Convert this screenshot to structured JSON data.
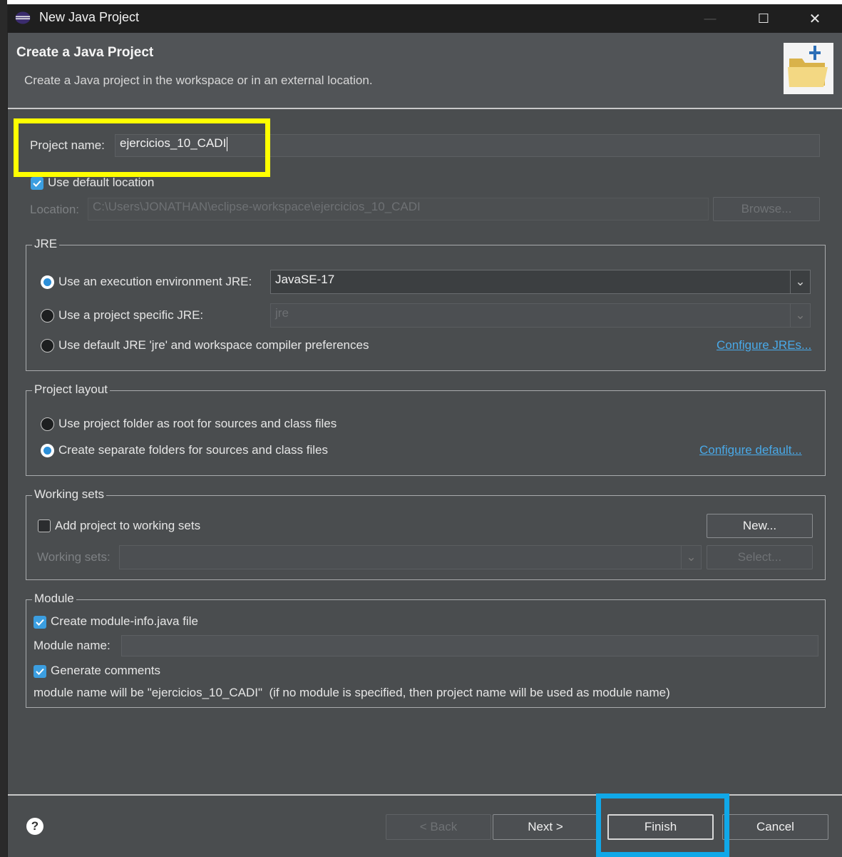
{
  "window": {
    "title": "New Java Project",
    "controls": [
      "—",
      "☐",
      "✕"
    ]
  },
  "header": {
    "title": "Create a Java Project",
    "description": "Create a Java project in the workspace or in an external location."
  },
  "project": {
    "name_label": "Project name:",
    "name_value": "ejercicios_10_CADI",
    "use_default_location_label": "Use default location",
    "use_default_location_checked": true,
    "location_label": "Location:",
    "location_value": "C:\\Users\\JONATHAN\\eclipse-workspace\\ejercicios_10_CADI",
    "browse_label": "Browse..."
  },
  "jre": {
    "group_title": "JRE",
    "option_env_label": "Use an execution environment JRE:",
    "option_env_value": "JavaSE-17",
    "option_specific_label": "Use a project specific JRE:",
    "option_specific_value": "jre",
    "option_default_label": "Use default JRE 'jre' and workspace compiler preferences",
    "configure_link": "Configure JREs...",
    "selected": "env"
  },
  "layout": {
    "group_title": "Project layout",
    "option_root_label": "Use project folder as root for sources and class files",
    "option_separate_label": "Create separate folders for sources and class files",
    "configure_link": "Configure default...",
    "selected": "separate"
  },
  "working_sets": {
    "group_title": "Working sets",
    "add_label": "Add project to working sets",
    "add_checked": false,
    "new_button": "New...",
    "sets_label": "Working sets:",
    "select_button": "Select..."
  },
  "module": {
    "group_title": "Module",
    "create_label": "Create module-info.java file",
    "create_checked": true,
    "name_label": "Module name:",
    "name_value": "",
    "generate_label": "Generate comments",
    "generate_checked": true,
    "info_text": "module name will be \"ejercicios_10_CADI\"  (if no module is specified, then project name will be used as module name)"
  },
  "footer": {
    "help": "?",
    "back_button": "< Back",
    "next_button": "Next >",
    "finish_button": "Finish",
    "cancel_button": "Cancel"
  },
  "colors": {
    "accent": "#3b9ee0",
    "highlight_yellow": "#ffff00",
    "highlight_blue": "#10a8e8",
    "link": "#49a9e8"
  }
}
